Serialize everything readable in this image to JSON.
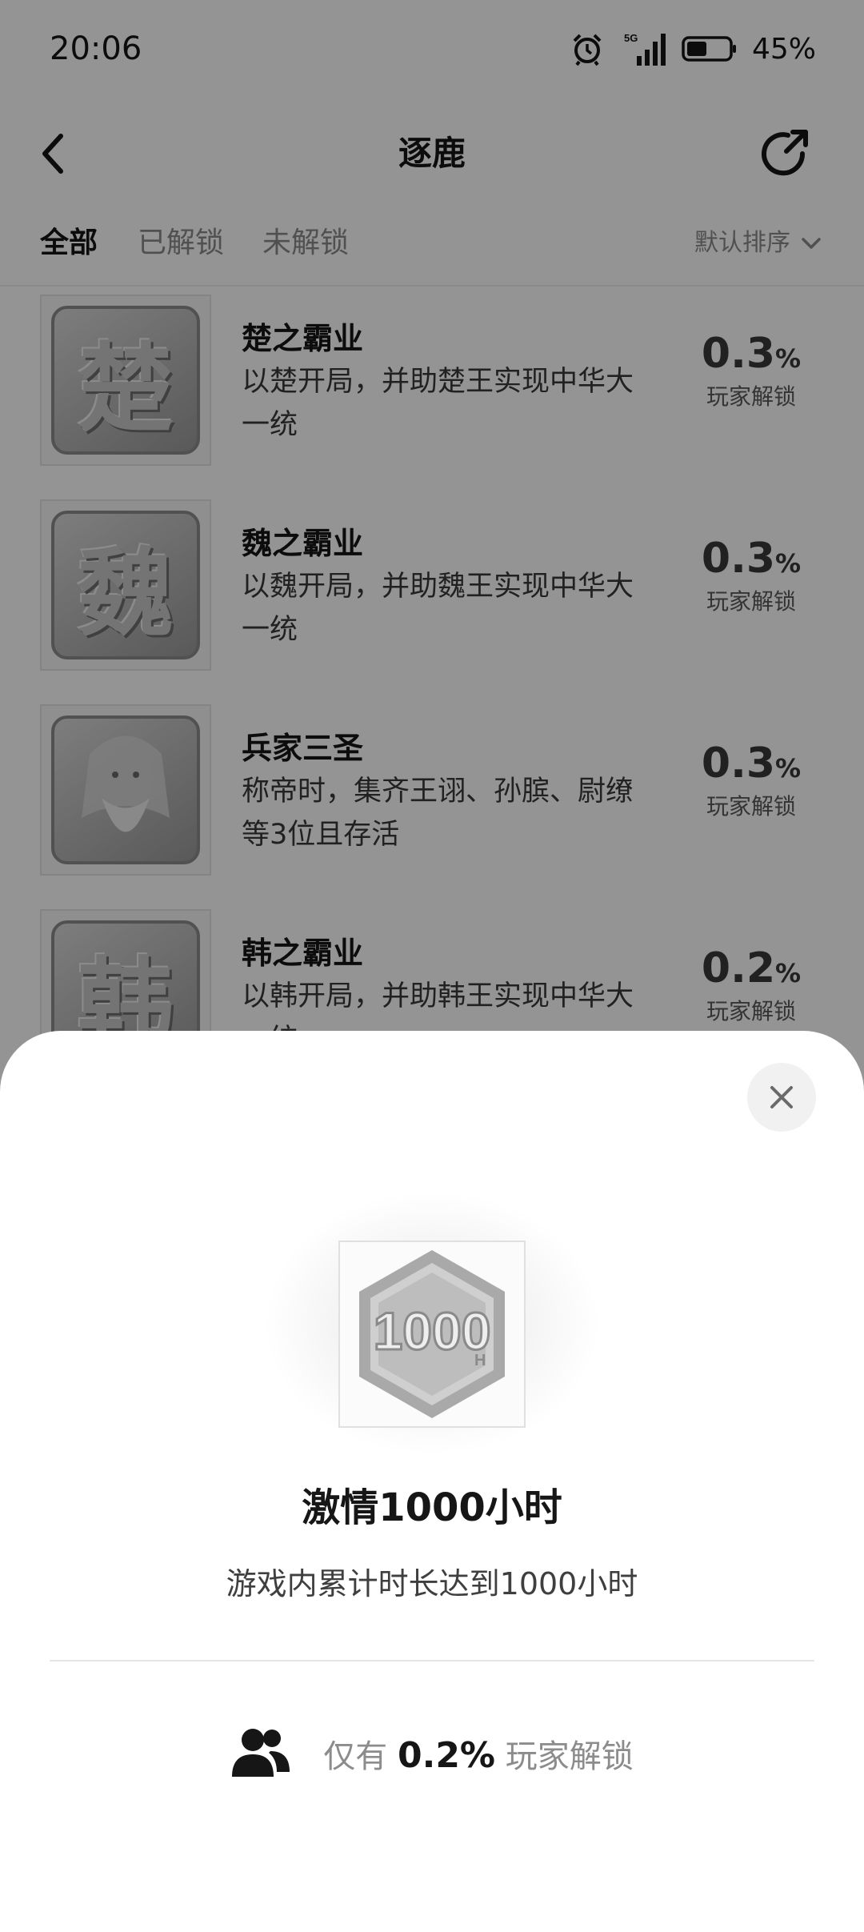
{
  "status_bar": {
    "time": "20:06",
    "network": "5G",
    "battery": "45%",
    "icons": [
      "alarm-icon",
      "signal-icon",
      "battery-icon"
    ]
  },
  "header": {
    "title": "逐鹿",
    "back_icon": "chevron-left-icon",
    "share_icon": "share-icon"
  },
  "tabs": {
    "items": [
      {
        "label": "全部",
        "active": true
      },
      {
        "label": "已解锁",
        "active": false
      },
      {
        "label": "未解锁",
        "active": false
      }
    ],
    "sort_label": "默认排序"
  },
  "achievements": [
    {
      "icon_glyph": "楚",
      "name": "楚之霸业",
      "desc": "以楚开局，并助楚王实现中华大一统",
      "rate": "0.3",
      "pct": "%",
      "rate_label": "玩家解锁"
    },
    {
      "icon_glyph": "魏",
      "name": "魏之霸业",
      "desc": "以魏开局，并助魏王实现中华大一统",
      "rate": "0.3",
      "pct": "%",
      "rate_label": "玩家解锁"
    },
    {
      "icon_glyph": "",
      "name": "兵家三圣",
      "desc": "称帝时，集齐王诩、孙膑、尉缭等3位且存活",
      "rate": "0.3",
      "pct": "%",
      "rate_label": "玩家解锁"
    },
    {
      "icon_glyph": "韩",
      "name": "韩之霸业",
      "desc": "以韩开局，并助韩王实现中华大一统",
      "rate": "0.2",
      "pct": "%",
      "rate_label": "玩家解锁"
    }
  ],
  "sheet": {
    "badge_text": "1000",
    "badge_subscript": "H",
    "title": "激情1000小时",
    "desc": "游戏内累计时长达到1000小时",
    "stat_prefix": "仅有",
    "stat_value": "0.2%",
    "stat_suffix": "玩家解锁",
    "close_icon": "close-icon",
    "users_icon": "users-icon"
  },
  "colors": {
    "overlay": "#000000",
    "text_primary": "#161616",
    "text_secondary": "#8c8c8c"
  }
}
